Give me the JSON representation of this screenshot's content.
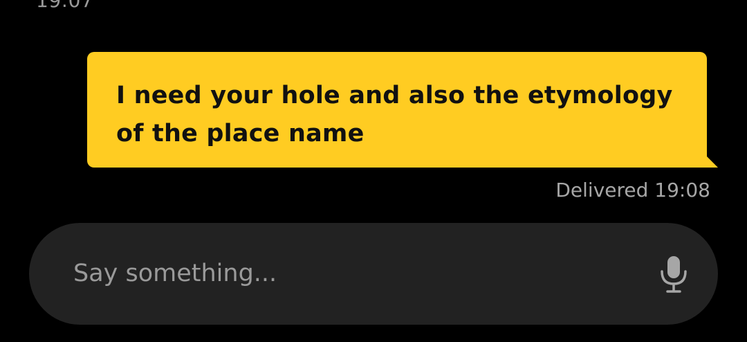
{
  "chat": {
    "previous_timestamp": "19:07",
    "outgoing_message": {
      "text": "I need your hole and also the etymology of the place name",
      "status": "Delivered 19:08"
    }
  },
  "composer": {
    "placeholder": "Say something...",
    "mic_icon": "microphone-icon"
  },
  "colors": {
    "background": "#000000",
    "bubble": "#ffcc22",
    "composer": "#222222"
  }
}
